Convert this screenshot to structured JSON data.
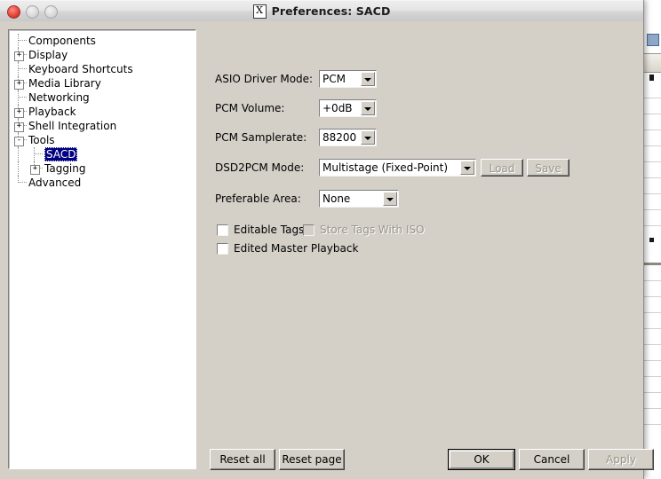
{
  "window": {
    "title": "Preferences: SACD",
    "icon": "x11-icon",
    "icon_glyph": "X",
    "traffic_lights": [
      "close",
      "minimize",
      "zoom"
    ]
  },
  "sidebar": {
    "items": [
      {
        "label": "Components",
        "depth": 0,
        "expander": "",
        "selected": false
      },
      {
        "label": "Display",
        "depth": 0,
        "expander": "+",
        "selected": false
      },
      {
        "label": "Keyboard Shortcuts",
        "depth": 0,
        "expander": "",
        "selected": false
      },
      {
        "label": "Media Library",
        "depth": 0,
        "expander": "+",
        "selected": false
      },
      {
        "label": "Networking",
        "depth": 0,
        "expander": "",
        "selected": false
      },
      {
        "label": "Playback",
        "depth": 0,
        "expander": "+",
        "selected": false
      },
      {
        "label": "Shell Integration",
        "depth": 0,
        "expander": "+",
        "selected": false
      },
      {
        "label": "Tools",
        "depth": 0,
        "expander": "-",
        "selected": false
      },
      {
        "label": "SACD",
        "depth": 1,
        "expander": "",
        "selected": true
      },
      {
        "label": "Tagging",
        "depth": 1,
        "expander": "+",
        "selected": false
      },
      {
        "label": "Advanced",
        "depth": 0,
        "expander": "",
        "selected": false
      }
    ]
  },
  "form": {
    "asio_driver_mode": {
      "label": "ASIO Driver Mode:",
      "value": "PCM"
    },
    "pcm_volume": {
      "label": "PCM Volume:",
      "value": "+0dB"
    },
    "pcm_samplerate": {
      "label": "PCM Samplerate:",
      "value": "88200"
    },
    "dsd2pcm_mode": {
      "label": "DSD2PCM Mode:",
      "value": "Multistage (Fixed-Point)"
    },
    "preferable_area": {
      "label": "Preferable Area:",
      "value": "None"
    },
    "load_button": "Load",
    "save_button": "Save",
    "checkboxes": [
      {
        "label": "Editable Tags",
        "checked": false,
        "enabled": true
      },
      {
        "label": "Store Tags With ISO",
        "checked": false,
        "enabled": false
      },
      {
        "label": "Edited Master Playback",
        "checked": false,
        "enabled": true
      }
    ]
  },
  "footer": {
    "reset_all": "Reset all",
    "reset_page": "Reset page",
    "ok": "OK",
    "cancel": "Cancel",
    "apply": "Apply"
  },
  "colors": {
    "dialog_background": "#d4d0c8",
    "selection": "#000080",
    "selection_text": "#ffffff",
    "disabled_text": "#9a958c",
    "field_background": "#ffffff"
  }
}
